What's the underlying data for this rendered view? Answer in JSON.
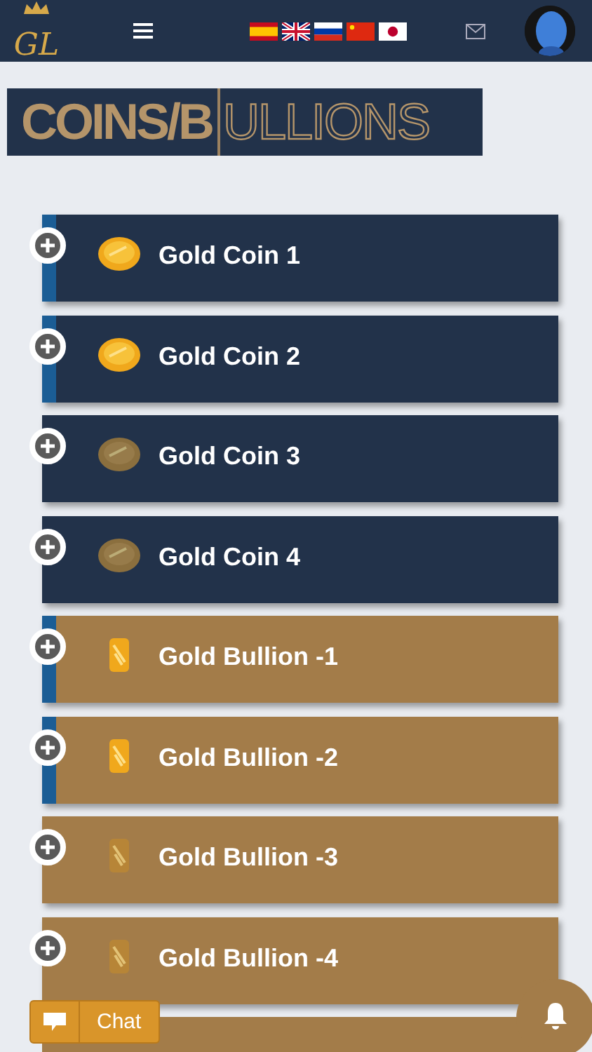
{
  "header": {
    "logo": "GL"
  },
  "banner": {
    "filled": "COINS/B",
    "outlined": "ULLIONS"
  },
  "items": [
    {
      "kind": "coin",
      "title": "Gold Coin 1",
      "highlighted": true
    },
    {
      "kind": "coin",
      "title": "Gold Coin 2",
      "highlighted": true
    },
    {
      "kind": "coin",
      "title": "Gold Coin 3",
      "highlighted": false
    },
    {
      "kind": "coin",
      "title": "Gold Coin 4",
      "highlighted": false
    },
    {
      "kind": "bullion",
      "title": "Gold Bullion -1",
      "highlighted": true
    },
    {
      "kind": "bullion",
      "title": "Gold Bullion -2",
      "highlighted": true
    },
    {
      "kind": "bullion",
      "title": "Gold Bullion -3",
      "highlighted": false
    },
    {
      "kind": "bullion",
      "title": "Gold Bullion -4",
      "highlighted": false
    }
  ],
  "chat": {
    "label": "Chat"
  }
}
